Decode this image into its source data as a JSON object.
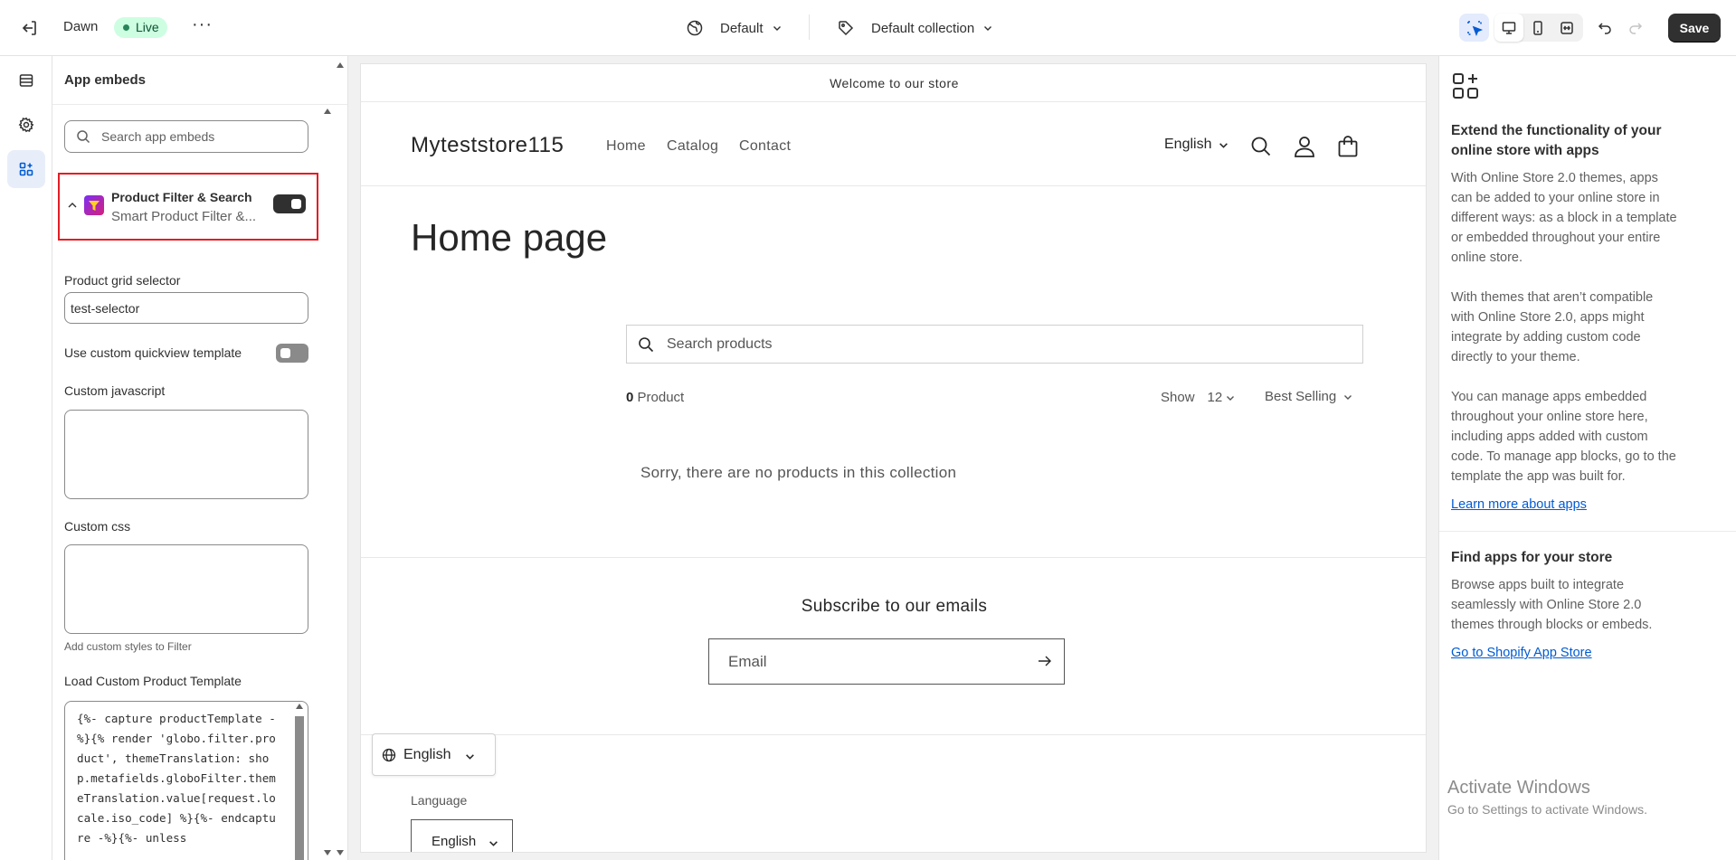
{
  "topbar": {
    "theme_name": "Dawn",
    "status_badge": "Live",
    "template_select": "Default",
    "collection_select": "Default collection",
    "save_label": "Save"
  },
  "panel": {
    "title": "App embeds",
    "search_placeholder": "Search app embeds",
    "app": {
      "name": "Product Filter & Search",
      "subtitle": "Smart Product Filter &...",
      "enabled": true
    },
    "fields": {
      "grid_selector_label": "Product grid selector",
      "grid_selector_value": "test-selector",
      "quickview_label": "Use custom quickview template",
      "quickview_enabled": false,
      "js_label": "Custom javascript",
      "css_label": "Custom css",
      "css_helper": "Add custom styles to Filter",
      "template_label": "Load Custom Product Template",
      "template_code": "{%- capture productTemplate -%}{% render 'globo.filter.product', themeTranslation: shop.metafields.globoFilter.themeTranslation.value[request.locale.iso_code] %}{%- endcapture -%}{%- unless"
    }
  },
  "store": {
    "announcement": "Welcome to our store",
    "name": "Myteststore115",
    "nav": [
      "Home",
      "Catalog",
      "Contact"
    ],
    "language": "English",
    "page_title": "Home page",
    "search_placeholder": "Search products",
    "product_count": "0",
    "product_count_label": "Product",
    "show_label": "Show",
    "show_value": "12",
    "sort_value": "Best Selling",
    "empty_message": "Sorry, there are no products in this collection",
    "subscribe_title": "Subscribe to our emails",
    "email_placeholder": "Email",
    "floating_language": "English",
    "footer_language_label": "Language",
    "footer_language": "English"
  },
  "info": {
    "title": "Extend the functionality of your online store with apps",
    "para1": "With Online Store 2.0 themes, apps can be added to your online store in different ways: as a block in a template or embedded throughout your entire online store.",
    "para2": "With themes that aren’t compatible with Online Store 2.0, apps might integrate by adding custom code directly to your theme.",
    "para3": "You can manage apps embedded throughout your online store here, including apps added with custom code. To manage app blocks, go to the template the app was built for.",
    "learn_link": "Learn more about apps",
    "find_title": "Find apps for your store",
    "find_para": "Browse apps built to integrate seamlessly with Online Store 2.0 themes through blocks or embeds.",
    "store_link": "Go to Shopify App Store"
  },
  "watermark": {
    "line1": "Activate Windows",
    "line2": "Go to Settings to activate Windows."
  }
}
